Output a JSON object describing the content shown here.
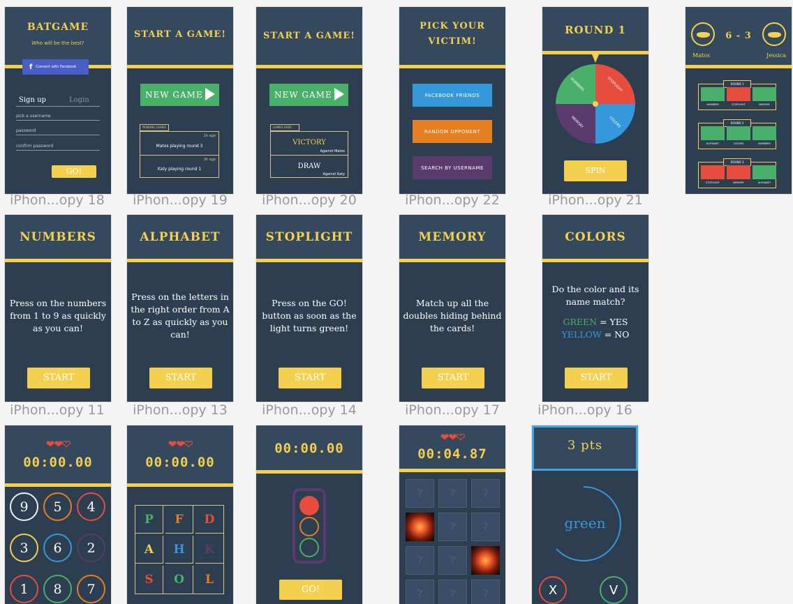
{
  "captions": [
    "iPhon...opy 18",
    "iPhon...opy 19",
    "iPhon...opy 20",
    "iPhon...opy 22",
    "iPhon...opy 21",
    "iPhon...opy 11",
    "iPhon...opy 13",
    "iPhon...opy 14",
    "iPhon...opy 17",
    "iPhon...opy 16"
  ],
  "login": {
    "title": "BATGAME",
    "subtitle": "Who will be the best?",
    "fb_label": "Connect with Facebook",
    "signup_tab": "Sign up",
    "login_tab": "Login",
    "username_ph": "pick a username",
    "password_ph": "password",
    "confirm_ph": "confirm password",
    "go": "GO!"
  },
  "start1": {
    "title": "START A GAME!",
    "new_game": "NEW GAME",
    "panel_label": "PENDING GAMES",
    "games": [
      {
        "time": "1h ago",
        "text": "Matos playing round 3"
      },
      {
        "time": "3h ago",
        "text": "Katy playing round 1"
      }
    ]
  },
  "start2": {
    "title": "START A GAME!",
    "new_game": "NEW GAME",
    "panel_label": "GAMES OVER",
    "games": [
      {
        "result": "VICTORY",
        "against": "Against Matos"
      },
      {
        "result": "DRAW",
        "against": "Against Katy"
      }
    ]
  },
  "victim": {
    "title_l1": "PICK YOUR",
    "title_l2": "VICTIM!",
    "fb": "FACEBOOK FRIENDS",
    "random": "RANDOM OPPONENT",
    "search": "SEARCH BY USERNAME",
    "colors": {
      "fb": "#3498db",
      "random": "#e67e22",
      "search": "#5b3a6e"
    }
  },
  "wheel": {
    "title": "ROUND 1",
    "segments": [
      "NUMBERS",
      "STOPLIGHT",
      "COLORS",
      "MEMORY"
    ],
    "spin": "SPIN"
  },
  "score": {
    "score": "6 - 3",
    "p1": "Matos",
    "p2": "Jessica",
    "rounds": [
      {
        "label": "ROUND 1",
        "cells": [
          "NUMBERS",
          "STOPLIGHT",
          "MEMORY"
        ],
        "colors": [
          "#48b06a",
          "#e74c3c",
          "#48b06a"
        ]
      },
      {
        "label": "ROUND 2",
        "cells": [
          "ALPHABET",
          "COLORS",
          "NUMBERS"
        ],
        "colors": [
          "#48b06a",
          "#48b06a",
          "#48b06a"
        ]
      },
      {
        "label": "ROUND 3",
        "cells": [
          "STOPLIGHT",
          "MEMORY",
          "ALPHABET"
        ],
        "colors": [
          "#e74c3c",
          "#e74c3c",
          "#48b06a"
        ]
      }
    ]
  },
  "instructions": [
    {
      "title": "NUMBERS",
      "text": "Press on the numbers from 1 to 9 as quickly as you can!",
      "start": "START"
    },
    {
      "title": "ALPHABET",
      "text": "Press on the letters in the right order from A to Z as quickly as you can!",
      "start": "START"
    },
    {
      "title": "STOPLIGHT",
      "text": "Press on the GO! button as soon as the light turns green!",
      "start": "START"
    },
    {
      "title": "MEMORY",
      "text": "Match up all the doubles hiding behind the cards!",
      "start": "START"
    },
    {
      "title": "COLORS",
      "text": "Do the color and its name match?",
      "green": "GREEN",
      "eq1": "= YES",
      "yellow": "YELLOW",
      "eq2": "= NO",
      "start": "START"
    }
  ],
  "numbers_game": {
    "timer": "00:00.00",
    "cells": [
      {
        "n": "9",
        "c": "#ecf0f1"
      },
      {
        "n": "5",
        "c": "#e67e22"
      },
      {
        "n": "4",
        "c": "#e74c3c"
      },
      {
        "n": "3",
        "c": "#f5d04f"
      },
      {
        "n": "6",
        "c": "#3498db"
      },
      {
        "n": "2",
        "c": "#5b3a6e"
      },
      {
        "n": "1",
        "c": "#e74c3c"
      },
      {
        "n": "8",
        "c": "#48b06a"
      },
      {
        "n": "7",
        "c": "#e67e22"
      }
    ]
  },
  "alpha_game": {
    "timer": "00:00.00",
    "cells": [
      {
        "l": "P",
        "c": "#48b06a"
      },
      {
        "l": "F",
        "c": "#e67e22"
      },
      {
        "l": "D",
        "c": "#e74c3c"
      },
      {
        "l": "A",
        "c": "#f5d04f"
      },
      {
        "l": "H",
        "c": "#3498db"
      },
      {
        "l": "K",
        "c": "#5b3a6e"
      },
      {
        "l": "S",
        "c": "#e74c3c"
      },
      {
        "l": "O",
        "c": "#48b06a"
      },
      {
        "l": "L",
        "c": "#e67e22"
      }
    ]
  },
  "stop_game": {
    "timer": "00:00.00",
    "go": "GO!"
  },
  "memory_game": {
    "timer": "00:04.87",
    "q": "?"
  },
  "colors_game": {
    "pts": "3 pts",
    "word": "green",
    "no": "X",
    "yes": "V"
  }
}
